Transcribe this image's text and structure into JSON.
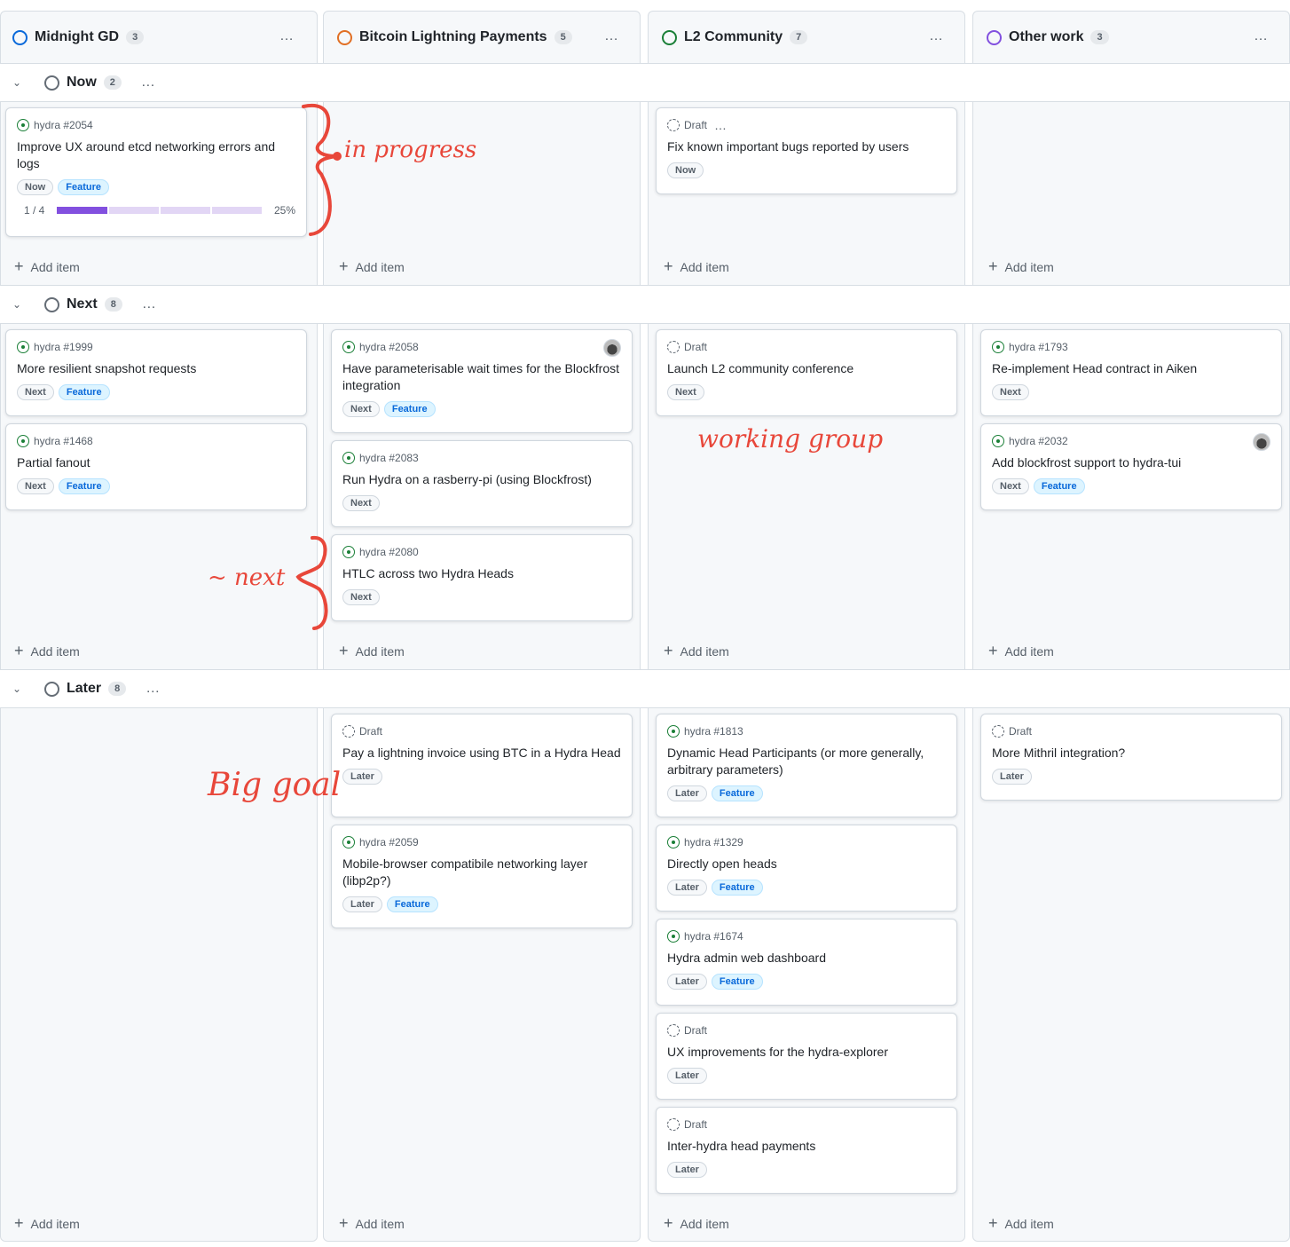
{
  "columns": [
    {
      "name": "Midnight GD",
      "count": "3",
      "color": "#0969da"
    },
    {
      "name": "Bitcoin Lightning Payments",
      "count": "5",
      "color": "#e16f24"
    },
    {
      "name": "L2 Community",
      "count": "7",
      "color": "#1a7f37"
    },
    {
      "name": "Other work",
      "count": "3",
      "color": "#8250df"
    }
  ],
  "more_icon": "…",
  "groups": {
    "now": {
      "label": "Now",
      "count": "2"
    },
    "next": {
      "label": "Next",
      "count": "8"
    },
    "later": {
      "label": "Later",
      "count": "8"
    }
  },
  "add_item_label": "Add item",
  "cards": {
    "c2054": {
      "ref": "hydra #2054",
      "title": "Improve UX around etcd networking errors and logs",
      "labels": [
        "Now",
        "Feature"
      ],
      "progress_text": "1 / 4",
      "progress_pct": "25%",
      "progress_value": 0.25
    },
    "draft_fix": {
      "ref": "Draft",
      "title": "Fix known important bugs reported by users",
      "labels": [
        "Now"
      ]
    },
    "c1999": {
      "ref": "hydra #1999",
      "title": "More resilient snapshot requests",
      "labels": [
        "Next",
        "Feature"
      ]
    },
    "c1468": {
      "ref": "hydra #1468",
      "title": "Partial fanout",
      "labels": [
        "Next",
        "Feature"
      ]
    },
    "c2058": {
      "ref": "hydra #2058",
      "title": "Have parameterisable wait times for the Blockfrost integration",
      "labels": [
        "Next",
        "Feature"
      ]
    },
    "c2083": {
      "ref": "hydra #2083",
      "title": "Run Hydra on a rasberry-pi (using Blockfrost)",
      "labels": [
        "Next"
      ]
    },
    "c2080": {
      "ref": "hydra #2080",
      "title": "HTLC across two Hydra Heads",
      "labels": [
        "Next"
      ]
    },
    "draft_conf": {
      "ref": "Draft",
      "title": "Launch L2 community conference",
      "labels": [
        "Next"
      ]
    },
    "c1793": {
      "ref": "hydra #1793",
      "title": "Re-implement Head contract in Aiken",
      "labels": [
        "Next"
      ]
    },
    "c2032": {
      "ref": "hydra #2032",
      "title": "Add blockfrost support to hydra-tui",
      "labels": [
        "Next",
        "Feature"
      ]
    },
    "draft_ln": {
      "ref": "Draft",
      "title": "Pay a lightning invoice using BTC in a Hydra Head",
      "labels": [
        "Later"
      ]
    },
    "c2059": {
      "ref": "hydra #2059",
      "title": "Mobile-browser compatibile networking layer (libp2p?)",
      "labels": [
        "Later",
        "Feature"
      ]
    },
    "c1813": {
      "ref": "hydra #1813",
      "title": "Dynamic Head Participants (or more generally, arbitrary parameters)",
      "labels": [
        "Later",
        "Feature"
      ]
    },
    "c1329": {
      "ref": "hydra #1329",
      "title": "Directly open heads",
      "labels": [
        "Later",
        "Feature"
      ]
    },
    "c1674": {
      "ref": "hydra #1674",
      "title": "Hydra admin web dashboard",
      "labels": [
        "Later",
        "Feature"
      ]
    },
    "draft_explorer": {
      "ref": "Draft",
      "title": "UX improvements for the hydra-explorer",
      "labels": [
        "Later"
      ]
    },
    "draft_inter": {
      "ref": "Draft",
      "title": "Inter-hydra head payments",
      "labels": [
        "Later"
      ]
    },
    "draft_mithril": {
      "ref": "Draft",
      "title": "More Mithril integration?",
      "labels": [
        "Later"
      ]
    }
  },
  "annotations": {
    "in_progress": "in progress",
    "next": "~ next",
    "working_group": "working group",
    "big_goal": "Big goal"
  },
  "colors": {
    "annotation": "#e8473a",
    "feature_label": "#0969da",
    "progress": "#8250df"
  }
}
